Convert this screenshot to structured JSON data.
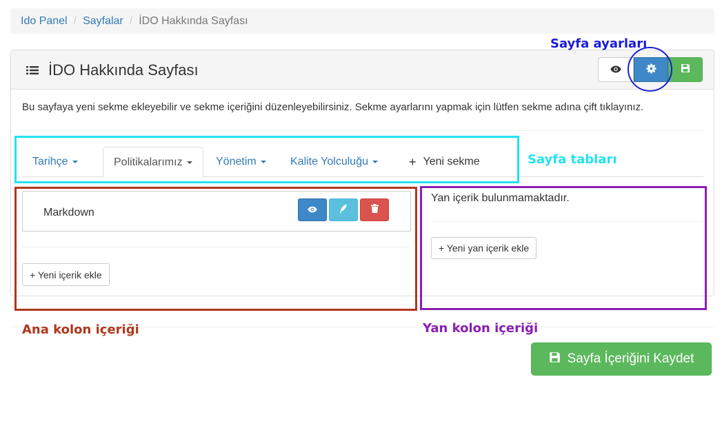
{
  "breadcrumb": {
    "items": [
      "Ido Panel",
      "Sayfalar"
    ],
    "current": "İDO Hakkında Sayfası"
  },
  "panel": {
    "title": "İDO Hakkında Sayfası",
    "description": "Bu sayfaya yeni sekme ekleyebilir ve sekme içeriğini düzenleyebilirsiniz. Sekme ayarlarını yapmak için lütfen sekme adına çift tıklayınız."
  },
  "tabs": [
    {
      "label": "Tarihçe",
      "active": false
    },
    {
      "label": "Politikalarımız",
      "active": true
    },
    {
      "label": "Yönetim",
      "active": false
    },
    {
      "label": "Kalite Yolculuğu",
      "active": false
    }
  ],
  "new_tab": {
    "label": "Yeni sekme"
  },
  "main": {
    "block_label": "Markdown",
    "add_content_label": "+ Yeni içerik ekle"
  },
  "side": {
    "empty_text": "Yan içerik bulunmamaktadır.",
    "add_side_label": "+ Yeni yan içerik ekle"
  },
  "annotations": {
    "page_settings": "Sayfa ayarları",
    "page_tabs": "Sayfa tabları",
    "main_column": "Ana kolon içeriği",
    "side_column": "Yan kolon içeriği"
  },
  "save_button": {
    "label": "Sayfa İçeriğini Kaydet"
  },
  "icons": {
    "preview": "eye-icon",
    "settings": "gear-icon",
    "save": "floppy-icon",
    "edit": "feather-icon",
    "delete": "trash-icon",
    "title": "list-icon"
  },
  "colors": {
    "primary": "#3f88c8",
    "success": "#5cb85c",
    "info": "#5bc0de",
    "danger": "#d9534f",
    "link": "#337ab7",
    "annotation_blue": "#1a1ad6",
    "annotation_cyan": "#22e3ef",
    "annotation_red": "#b0371c",
    "annotation_purple": "#8a1fb3"
  }
}
